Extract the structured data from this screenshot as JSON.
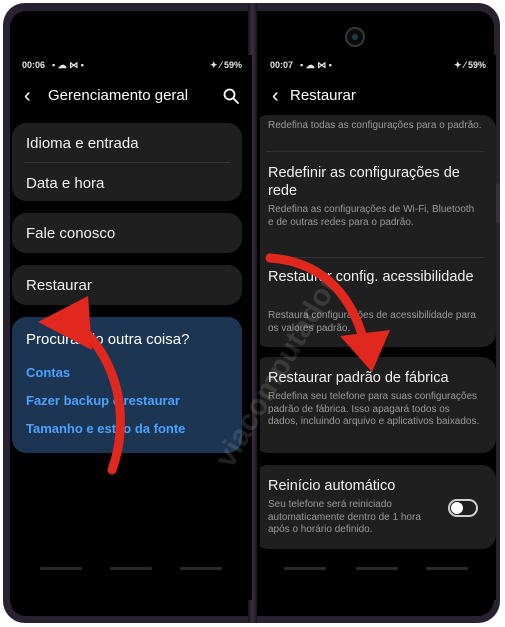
{
  "left_screen": {
    "status": {
      "time": "00:06",
      "left_icons": "▪ ☁ ⋈ •",
      "right_icons": "✦ ⁄ 59%"
    },
    "header": {
      "title": "Gerenciamento geral"
    },
    "items": [
      "Idioma e entrada",
      "Data e hora",
      "Fale conosco",
      "Restaurar"
    ],
    "suggest_card": {
      "title": "Procurando outra coisa?",
      "links": [
        "Contas",
        "Fazer backup e restaurar",
        "Tamanho e estilo da fonte"
      ]
    }
  },
  "right_screen": {
    "status": {
      "time": "00:07",
      "left_icons": "▪ ☁ ⋈ •",
      "right_icons": "✦ ⁄ 59%"
    },
    "header": {
      "title": "Restaurar"
    },
    "top_partial": "Redefina todas as configurações para o padrão.",
    "network": {
      "title": "Redefinir as configurações de rede",
      "description": "Redefina as configurações de Wi-Fi, Bluetooth e de outras redes para o padrão."
    },
    "accessibility": {
      "title": "Restaurar config. acessibilidade",
      "description": "Restaura configurações de acessibilidade para os valores padrão."
    },
    "factory": {
      "title": "Restaurar padrão de fábrica",
      "description": "Redefina seu telefone para suas configurações padrão de fábrica. Isso apagará todos os dados, incluindo arquivo e aplicativos baixados."
    },
    "auto_restart": {
      "title": "Reinício automático",
      "description": "Seu telefone será reiniciado automaticamente dentro de 1 hora após o horário definido.",
      "enabled": false
    }
  },
  "watermark": "viacomputador",
  "colors": {
    "accent_link": "#4aa3ff",
    "arrow": "#e0281e",
    "card": "#1f1f1f",
    "suggest_card": "#1c3552"
  }
}
